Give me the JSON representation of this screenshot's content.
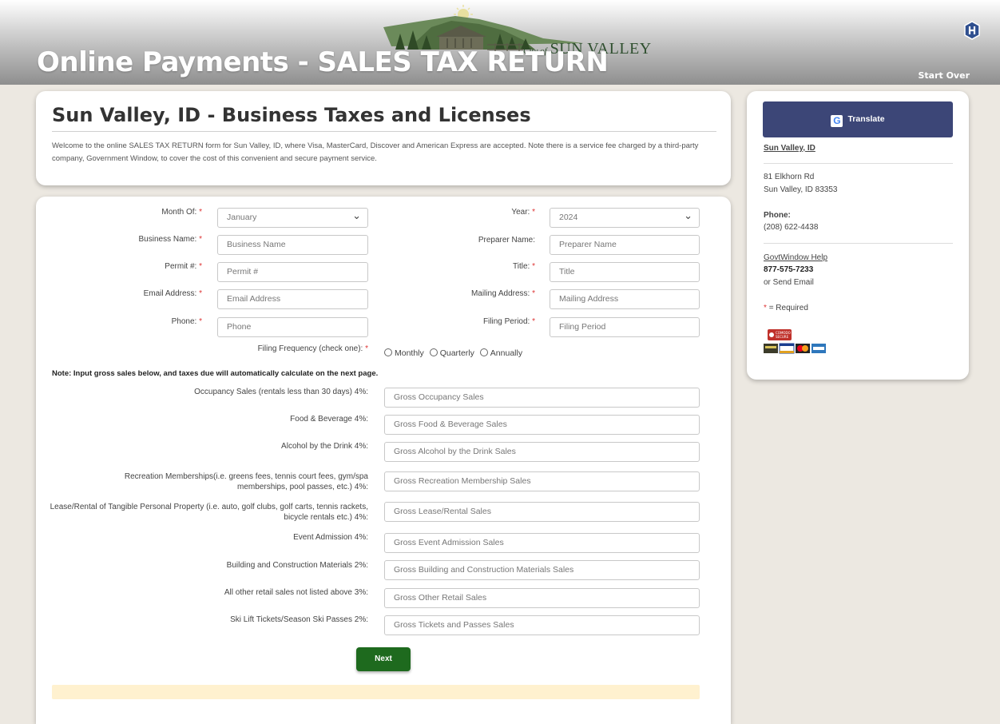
{
  "header": {
    "title": "Online Payments - SALES TAX RETURN",
    "logo_small": "City of",
    "logo_big": "SUN VALLEY",
    "start_over": "Start Over"
  },
  "intro": {
    "heading": "Sun Valley, ID - Business Taxes and Licenses",
    "text": "Welcome to the online SALES TAX RETURN form for Sun Valley, ID, where Visa, MasterCard, Discover and American Express are accepted. Note there is a service fee charged by a third-party company, Government Window, to cover the cost of this convenient and secure payment service."
  },
  "form": {
    "month_label": "Month Of:",
    "month_value": "January",
    "year_label": "Year:",
    "year_value": "2024",
    "business_label": "Business Name:",
    "business_placeholder": "Business Name",
    "preparer_label": "Preparer Name:",
    "preparer_placeholder": "Preparer Name",
    "permit_label": "Permit #:",
    "permit_placeholder": "Permit #",
    "title_label": "Title:",
    "title_placeholder": "Title",
    "email_label": "Email Address:",
    "email_placeholder": "Email Address",
    "mailing_label": "Mailing Address:",
    "mailing_placeholder": "Mailing Address",
    "phone_label": "Phone:",
    "phone_placeholder": "Phone",
    "period_label": "Filing Period:",
    "period_placeholder": "Filing Period",
    "frequency_label": "Filing Frequency (check one):",
    "freq_monthly": "Monthly",
    "freq_quarterly": "Quarterly",
    "freq_annually": "Annually",
    "required_mark": "*",
    "note": "Note: Input gross sales below, and taxes due will automatically calculate on the next page.",
    "sales": [
      {
        "label": "Occupancy Sales (rentals less than 30 days) 4%:",
        "placeholder": "Gross Occupancy Sales"
      },
      {
        "label": "Food & Beverage 4%:",
        "placeholder": "Gross Food & Beverage Sales"
      },
      {
        "label": "Alcohol by the Drink 4%:",
        "placeholder": "Gross Alcohol by the Drink Sales"
      },
      {
        "label": "Recreation Memberships(i.e. greens fees, tennis court fees, gym/spa memberships, pool passes, etc.) 4%:",
        "placeholder": "Gross Recreation Membership Sales"
      },
      {
        "label": "Lease/Rental of Tangible Personal Property (i.e. auto, golf clubs, golf carts, tennis rackets, bicycle rentals etc.) 4%:",
        "placeholder": "Gross Lease/Rental Sales"
      },
      {
        "label": "Event Admission 4%:",
        "placeholder": "Gross Event Admission Sales"
      },
      {
        "label": "Building and Construction Materials 2%:",
        "placeholder": "Gross Building and Construction Materials Sales"
      },
      {
        "label": "All other retail sales not listed above 3%:",
        "placeholder": "Gross Other Retail Sales"
      },
      {
        "label": "Ski Lift Tickets/Season Ski Passes 2%:",
        "placeholder": "Gross Tickets and Passes Sales"
      }
    ],
    "next": "Next"
  },
  "sidebar": {
    "translate": "Translate",
    "city": "Sun Valley, ID",
    "address1": "81 Elkhorn Rd",
    "address2": "Sun Valley, ID 83353",
    "phone_label": "Phone:",
    "phone": "(208) 622-4438",
    "help_link": "GovtWindow Help",
    "help_phone": "877-575-7233",
    "send_email": "or Send Email",
    "required_note": "= Required",
    "comodo_top": "COMODO",
    "comodo_bottom": "SECURE"
  },
  "colors": {
    "next_button": "#1e6a1e",
    "translate_button": "#3c4677",
    "alert_bar": "#fff1cf",
    "required": "#dd3333"
  },
  "icons": [
    "govtwindow-logo-icon",
    "google-g-icon",
    "comodo-secure-badge-icon",
    "credit-cards-icon"
  ]
}
